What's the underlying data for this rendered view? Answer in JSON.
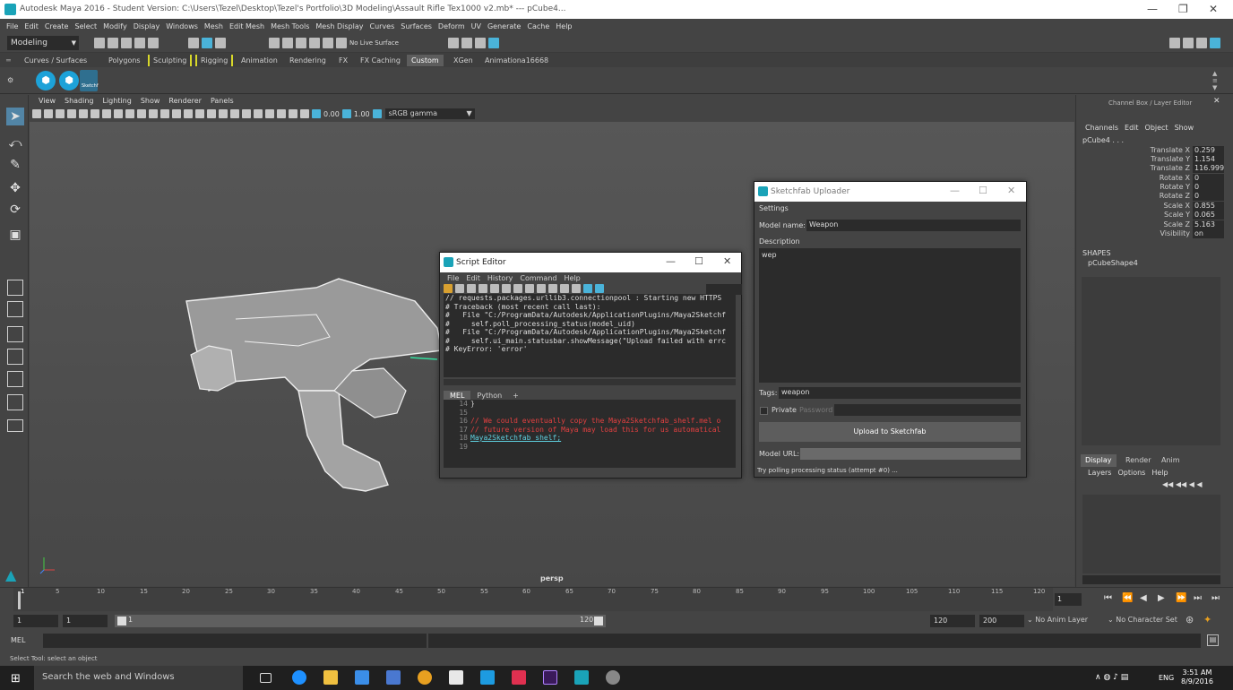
{
  "app": {
    "title": "Autodesk Maya 2016 - Student Version: C:\\Users\\Tezel\\Desktop\\Tezel's Portfolio\\3D Modeling\\Assault Rifle Tex1000 v2.mb*   ---   pCube4...",
    "menu": [
      "File",
      "Edit",
      "Create",
      "Select",
      "Modify",
      "Display",
      "Windows",
      "Mesh",
      "Edit Mesh",
      "Mesh Tools",
      "Mesh Display",
      "Curves",
      "Surfaces",
      "Deform",
      "UV",
      "Generate",
      "Cache",
      "Help"
    ],
    "mode": "Modeling",
    "live_surface": "No Live Surface"
  },
  "shelf": {
    "tabs": [
      "Curves / Surfaces",
      "Polygons",
      "Sculpting",
      "Rigging",
      "Animation",
      "Rendering",
      "FX",
      "FX Caching",
      "Custom",
      "XGen",
      "Animationa16668"
    ],
    "active_tab": "Custom",
    "sketchfab_label": "Sketchf"
  },
  "viewport": {
    "menus": [
      "View",
      "Shading",
      "Lighting",
      "Show",
      "Renderer",
      "Panels"
    ],
    "field1": "0.00",
    "field2": "1.00",
    "colorspace": "sRGB gamma",
    "camera": "persp"
  },
  "channel_box": {
    "title": "Channel Box / Layer Editor",
    "menus": [
      "Channels",
      "Edit",
      "Object",
      "Show"
    ],
    "object": "pCube4 . . .",
    "attributes": [
      {
        "name": "Translate X",
        "value": "0.259"
      },
      {
        "name": "Translate Y",
        "value": "1.154"
      },
      {
        "name": "Translate Z",
        "value": "116.999"
      },
      {
        "name": "Rotate X",
        "value": "0"
      },
      {
        "name": "Rotate Y",
        "value": "0"
      },
      {
        "name": "Rotate Z",
        "value": "0"
      },
      {
        "name": "Scale X",
        "value": "0.855"
      },
      {
        "name": "Scale Y",
        "value": "0.065"
      },
      {
        "name": "Scale Z",
        "value": "5.163"
      },
      {
        "name": "Visibility",
        "value": "on"
      }
    ],
    "shapes_label": "SHAPES",
    "shape": "pCubeShape4",
    "layer_tabs": [
      "Display",
      "Render",
      "Anim"
    ],
    "layer_menus": [
      "Layers",
      "Options",
      "Help"
    ]
  },
  "timeline": {
    "ticks": [
      "1",
      "5",
      "10",
      "15",
      "20",
      "25",
      "30",
      "35",
      "40",
      "45",
      "50",
      "55",
      "60",
      "65",
      "70",
      "75",
      "80",
      "85",
      "90",
      "95",
      "100",
      "105",
      "110",
      "115",
      "120"
    ],
    "current_frame": "1",
    "range_start": "1",
    "range_inner_start": "1",
    "range_bar_start": "1",
    "range_bar_end": "120",
    "range_end": "120",
    "anim_end": "200",
    "anim_layer": "No Anim Layer",
    "character_set": "No Character Set"
  },
  "command": {
    "label": "MEL",
    "help": "Select Tool: select an object"
  },
  "script_editor": {
    "title": "Script Editor",
    "menus": [
      "File",
      "Edit",
      "History",
      "Command",
      "Help"
    ],
    "output": [
      "// requests.packages.urllib3.connectionpool : Starting new HTTPS",
      "# Traceback (most recent call last):",
      "#   File \"C:/ProgramData/Autodesk/ApplicationPlugins/Maya2Sketchf",
      "#     self.poll_processing_status(model_uid)",
      "#   File \"C:/ProgramData/Autodesk/ApplicationPlugins/Maya2Sketchf",
      "#     self.ui_main.statusbar.showMessage(\"Upload failed with errc",
      "# KeyError: 'error'"
    ],
    "tabs": [
      "MEL",
      "Python",
      "+"
    ],
    "lines": [
      {
        "n": "14",
        "text": "}",
        "color": "normal"
      },
      {
        "n": "15",
        "text": "",
        "color": "normal"
      },
      {
        "n": "16",
        "text": "// We could eventually copy the Maya2Sketchfab_shelf.mel o",
        "color": "red"
      },
      {
        "n": "17",
        "text": "// future version of Maya may load this for us automatical",
        "color": "red"
      },
      {
        "n": "18",
        "text": "Maya2Sketchfab_shelf;",
        "color": "cyan"
      },
      {
        "n": "19",
        "text": "",
        "color": "normal"
      }
    ]
  },
  "sketchfab": {
    "title": "Sketchfab Uploader",
    "settings": "Settings",
    "model_name_label": "Model name:",
    "model_name": "Weapon",
    "description_label": "Description",
    "description": "wep",
    "tags_label": "Tags:",
    "tags": "weapon",
    "private_label": "Private",
    "password_placeholder": "Password",
    "upload_button": "Upload to Sketchfab",
    "model_url_label": "Model URL:",
    "status": "Try polling processing status (attempt #0) ..."
  },
  "taskbar": {
    "search_placeholder": "Search the web and Windows",
    "language": "ENG",
    "time": "3:51 AM",
    "date": "8/9/2016"
  },
  "colors": {
    "accent": "#1da2d8",
    "maya_bg": "#444444",
    "field_bg": "#2b2b2b"
  }
}
